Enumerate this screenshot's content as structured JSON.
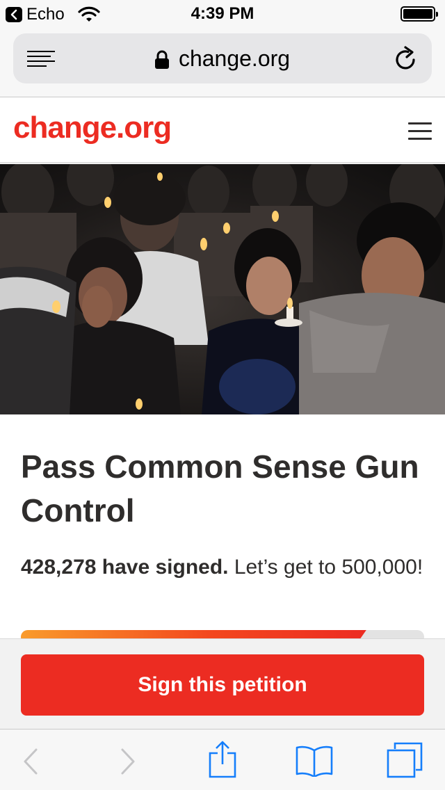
{
  "status_bar": {
    "back_app": "Echo",
    "time": "4:39 PM",
    "icons": [
      "back-chevron-icon",
      "wifi-icon",
      "battery-icon"
    ]
  },
  "browser": {
    "url": "change.org",
    "icons": [
      "reader-icon",
      "lock-icon",
      "reload-icon"
    ],
    "toolbar_icons": [
      "back-icon",
      "forward-icon",
      "share-icon",
      "bookmarks-icon",
      "tabs-icon"
    ]
  },
  "site": {
    "logo": "change.org",
    "menu_icon": "hamburger-menu-icon"
  },
  "hero": {
    "image": "candlelight-vigil-photo"
  },
  "petition": {
    "title": "Pass Common Sense Gun Control",
    "signed_count": "428,278 have signed.",
    "goal_text": "Let’s get to 500,000!",
    "progress_fraction": 0.8566
  },
  "cta": {
    "label": "Sign this petition"
  },
  "colors": {
    "brand_red": "#ec2c22",
    "progress_orange": "#f99b2b",
    "ios_blue": "#157efb"
  }
}
